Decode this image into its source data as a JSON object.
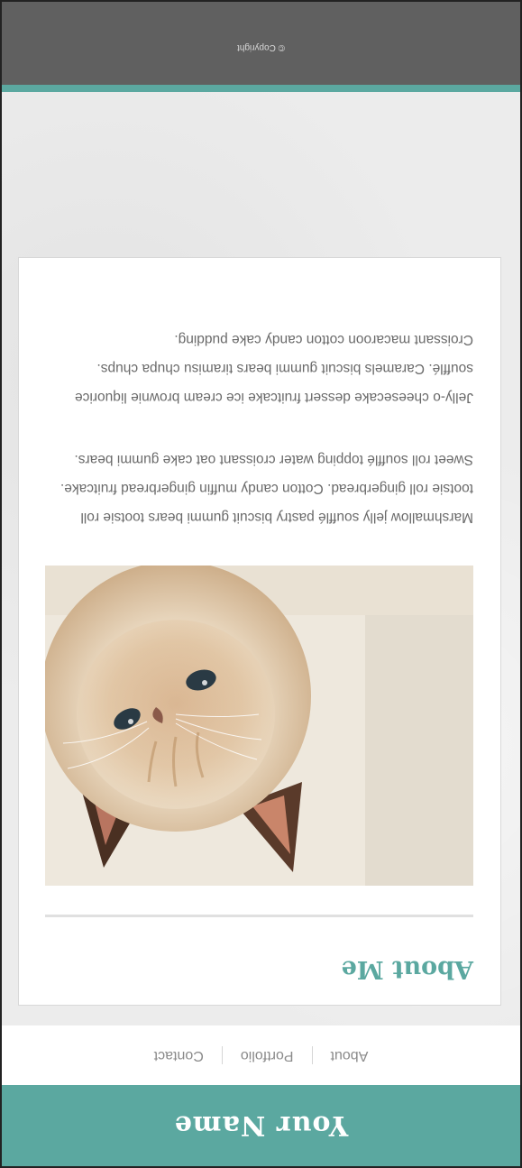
{
  "header": {
    "site_title": "Your Name"
  },
  "nav": {
    "items": [
      {
        "label": "About"
      },
      {
        "label": "Portfolio"
      },
      {
        "label": "Contact"
      }
    ]
  },
  "about": {
    "heading": "About Me",
    "paragraphs": [
      "Marshmallow jelly soufflé pastry biscuit gummi bears tootsie roll tootsie roll gingerbread. Cotton candy muffin gingerbread fruitcake. Sweet roll soufflé topping water croissant oat cake gummi bears.",
      "Jelly-o cheesecake dessert fruitcake ice cream brownie liquorice soufflé. Caramels biscuit gummi bears tiramisu chupa chups. Croissant macaroon cotton candy cake pudding."
    ]
  },
  "footer": {
    "copyright": "© Copyright"
  },
  "colors": {
    "accent": "#5ba8a0",
    "footer_bg": "#606060",
    "page_bg": "#ececec"
  }
}
